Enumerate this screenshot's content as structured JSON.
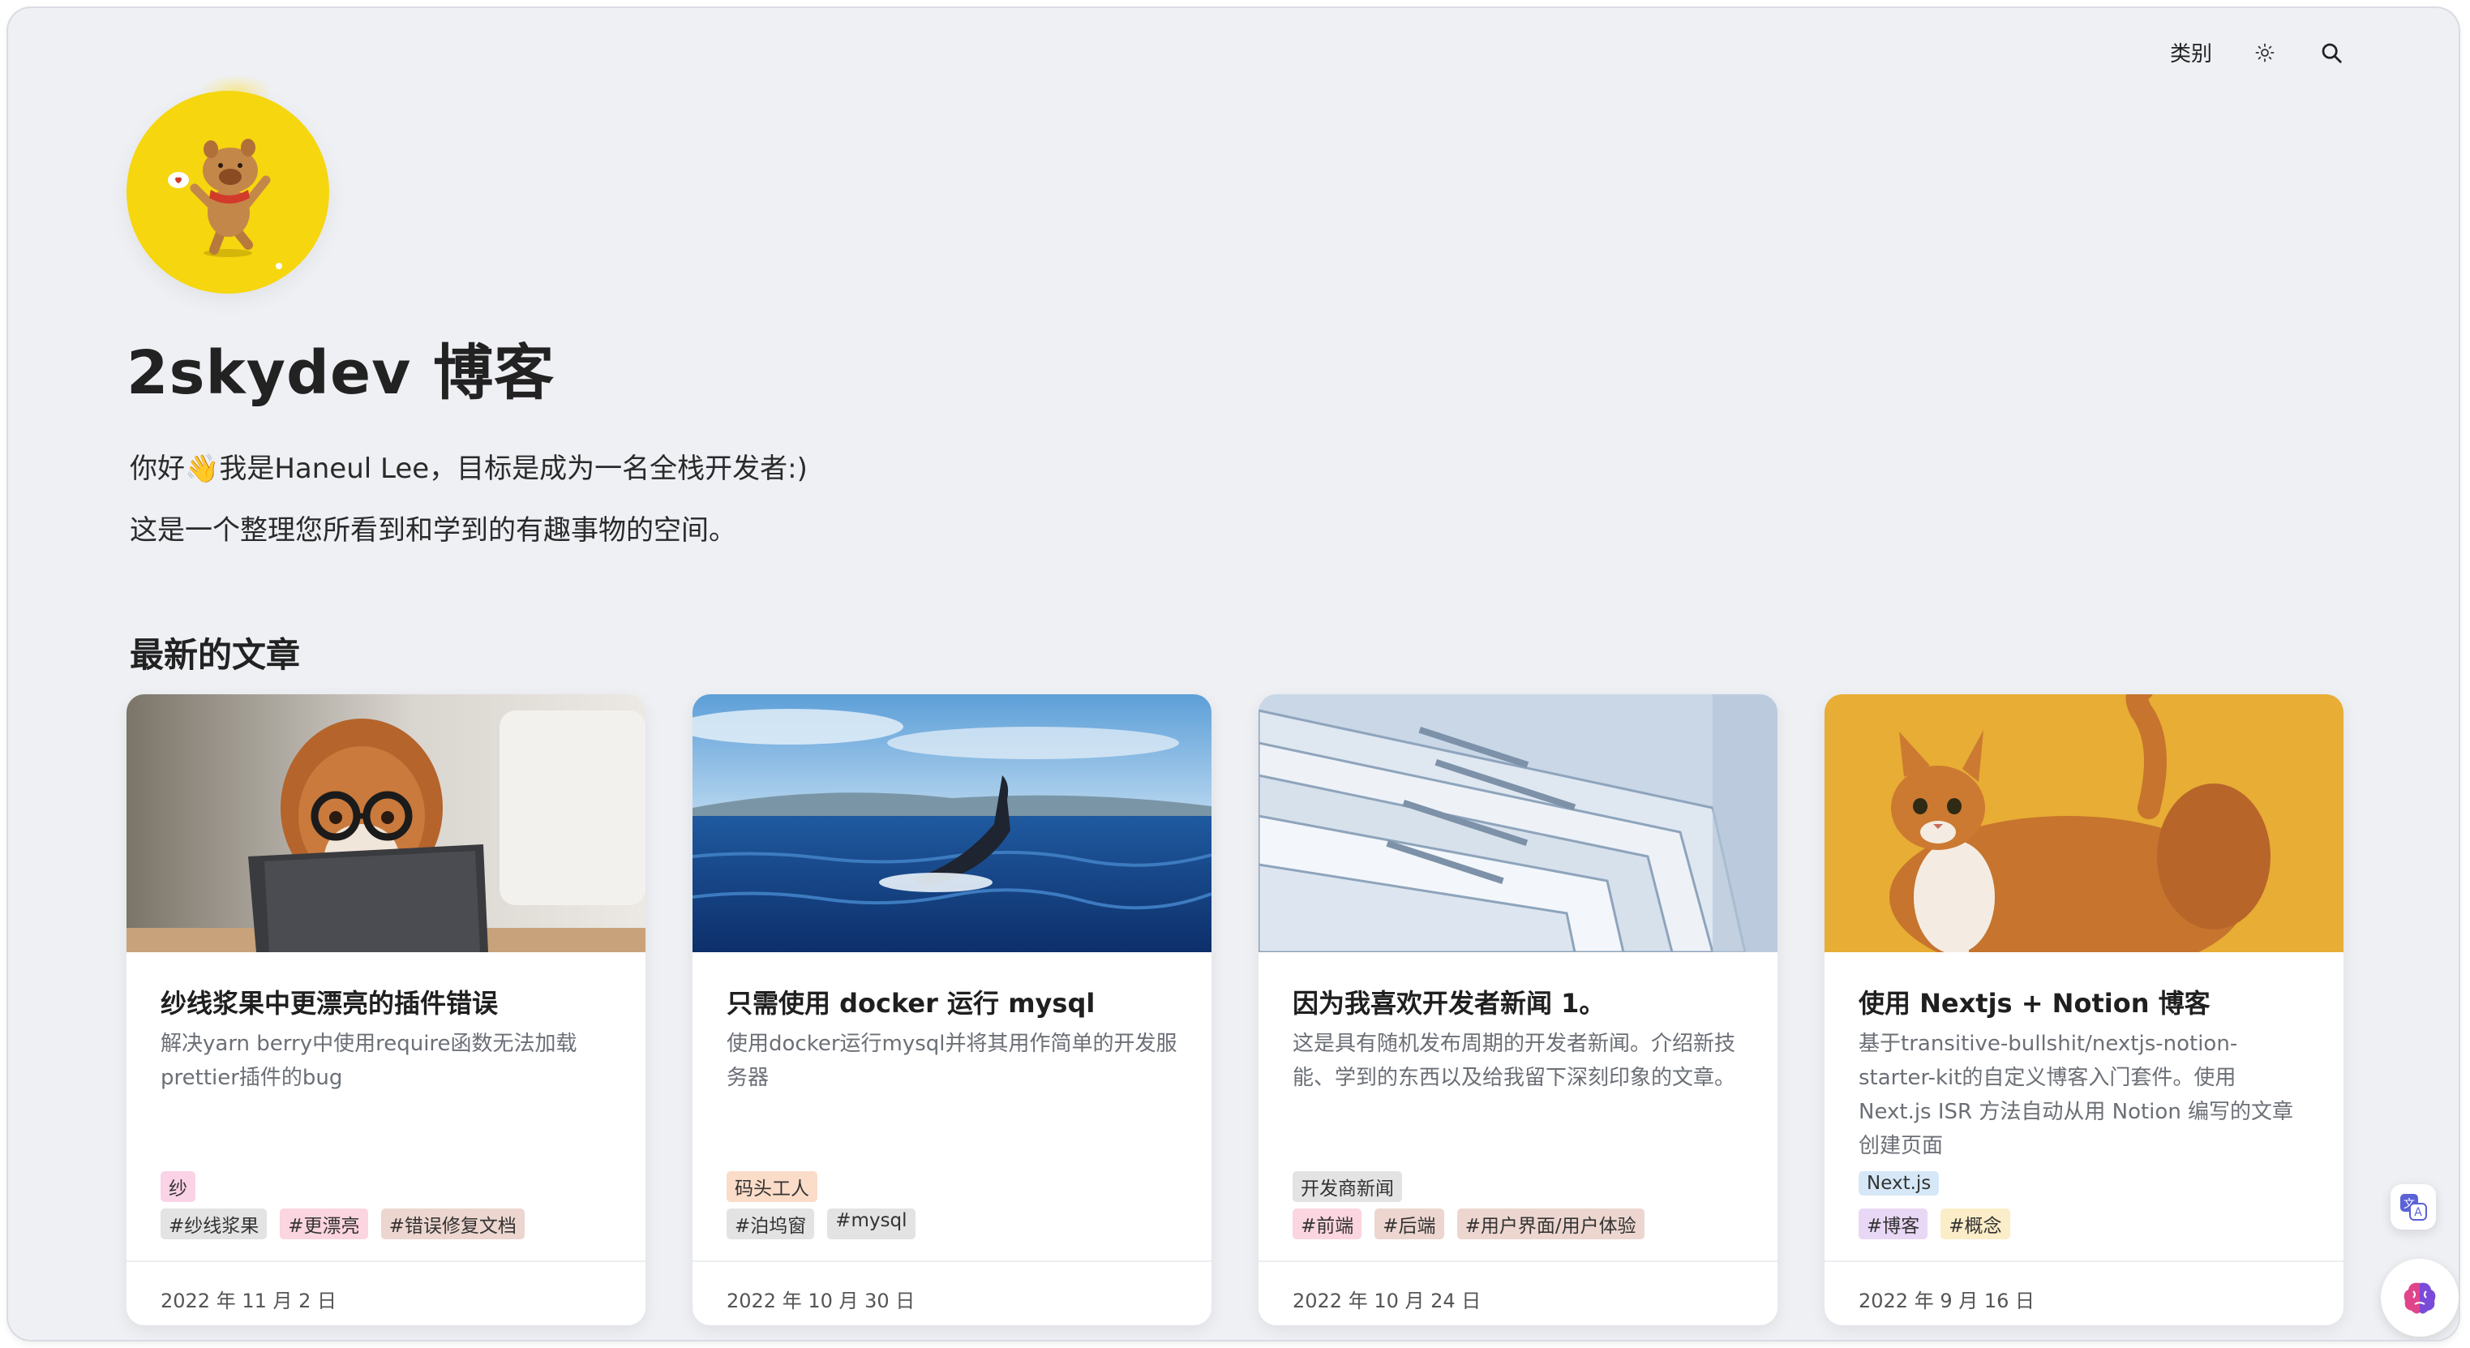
{
  "nav": {
    "category": "类别",
    "theme_icon": "sun-icon",
    "search_icon": "search-icon"
  },
  "profile": {
    "title": "2skydev 博客",
    "intro_line1": "你好👋我是Haneul Lee，目标是成为一名全栈开发者:)",
    "intro_line2": "这是一个整理您所看到和学到的有趣事物的空间。"
  },
  "section_title": "最新的文章",
  "cards": [
    {
      "title": "纱线浆果中更漂亮的插件错误",
      "desc": "解决yarn berry中使用require函数无法加载prettier插件的bug",
      "category": "纱",
      "category_color": "#fbd3e6",
      "tags": [
        "#纱线浆果",
        "#更漂亮",
        "#错误修复文档"
      ],
      "tag_colors": [
        "#e3e3e3",
        "#fbd5df",
        "#ecd6cf"
      ],
      "date": "2022 年 11 月 2 日",
      "image": "dog-with-glasses-laptop"
    },
    {
      "title": "只需使用 docker 运行 mysql",
      "desc": "使用docker运行mysql并将其用作简单的开发服务器",
      "category": "码头工人",
      "category_color": "#fbdcc8",
      "tags": [
        "#泊坞窗",
        "#mysql"
      ],
      "tag_colors": [
        "#e3e3e3",
        "#e3e3e3"
      ],
      "date": "2022 年 10 月 30 日",
      "image": "whale-tail-ocean"
    },
    {
      "title": "因为我喜欢开发者新闻 1。",
      "desc": "这是具有随机发布周期的开发者新闻。介绍新技能、学到的东西以及给我留下深刻印象的文章。",
      "category": "开发商新闻",
      "category_color": "#e3e3e3",
      "tags": [
        "#前端",
        "#后端",
        "#用户界面/用户体验"
      ],
      "tag_colors": [
        "#fbd5df",
        "#ecd6cf",
        "#ecd6cf"
      ],
      "date": "2022 年 10 月 24 日",
      "image": "newspapers-stack"
    },
    {
      "title": "使用 Nextjs + Notion 博客",
      "desc": "基于transitive-bullshit/nextjs-notion-starter-kit的自定义博客入门套件。使用 Next.js ISR 方法自动从用 Notion 编写的文章创建页面",
      "category": "Next.js",
      "category_color": "#d6e8f7",
      "tags": [
        "#博客",
        "#概念"
      ],
      "tag_colors": [
        "#e8d8f5",
        "#fbedc8"
      ],
      "date": "2022 年 9 月 16 日",
      "image": "orange-cat"
    }
  ],
  "fab": {
    "translate_icon": "translate-icon",
    "brain_icon": "brain-icon"
  }
}
